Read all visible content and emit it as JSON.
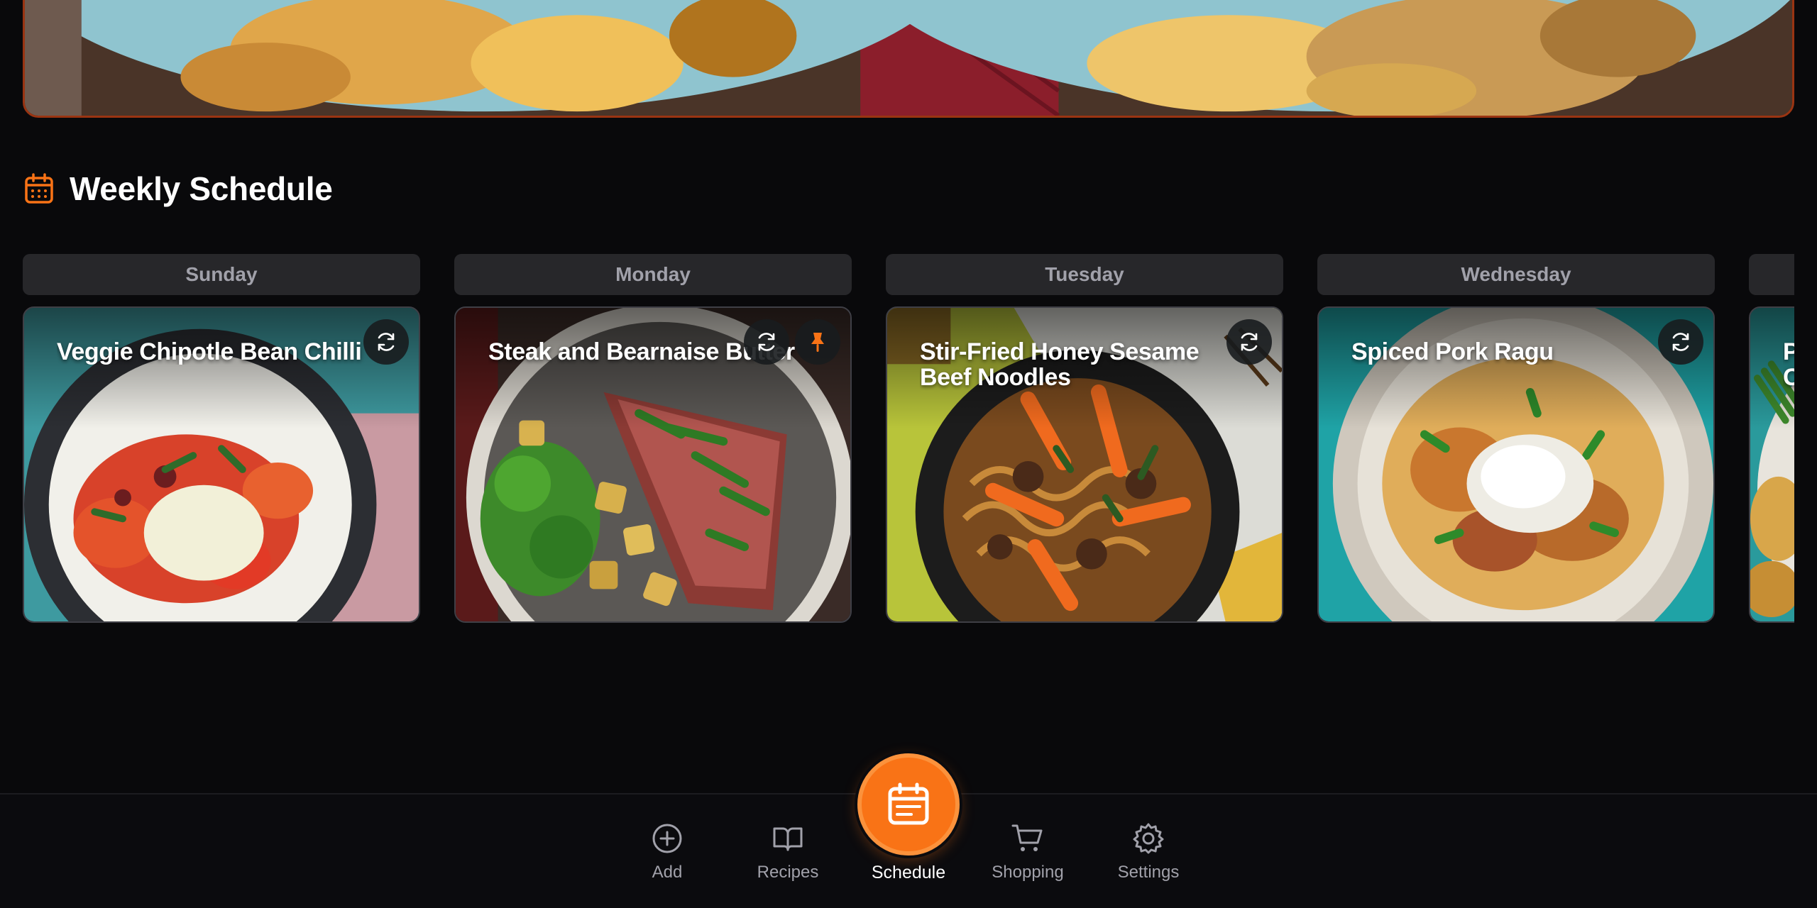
{
  "section": {
    "title": "Weekly Schedule",
    "icon": "calendar-icon",
    "accent": "#f97316"
  },
  "schedule": [
    {
      "day": "Sunday",
      "recipe": "Veggie Chipotle Bean Chilli",
      "pinned": false
    },
    {
      "day": "Monday",
      "recipe": "Steak and Bearnaise Butter",
      "pinned": true
    },
    {
      "day": "Tuesday",
      "recipe": "Stir-Fried Honey Sesame Beef Noodles",
      "pinned": false
    },
    {
      "day": "Wednesday",
      "recipe": "Spiced Pork Ragu",
      "pinned": false
    },
    {
      "day": "",
      "recipe": "P C",
      "pinned": false
    }
  ],
  "nav": {
    "add": "Add",
    "recipes": "Recipes",
    "schedule": "Schedule",
    "shopping": "Shopping",
    "settings": "Settings"
  },
  "colors": {
    "background": "#09090b",
    "pill": "#27272a",
    "muted": "#a1a1aa",
    "accent": "#f97316"
  }
}
